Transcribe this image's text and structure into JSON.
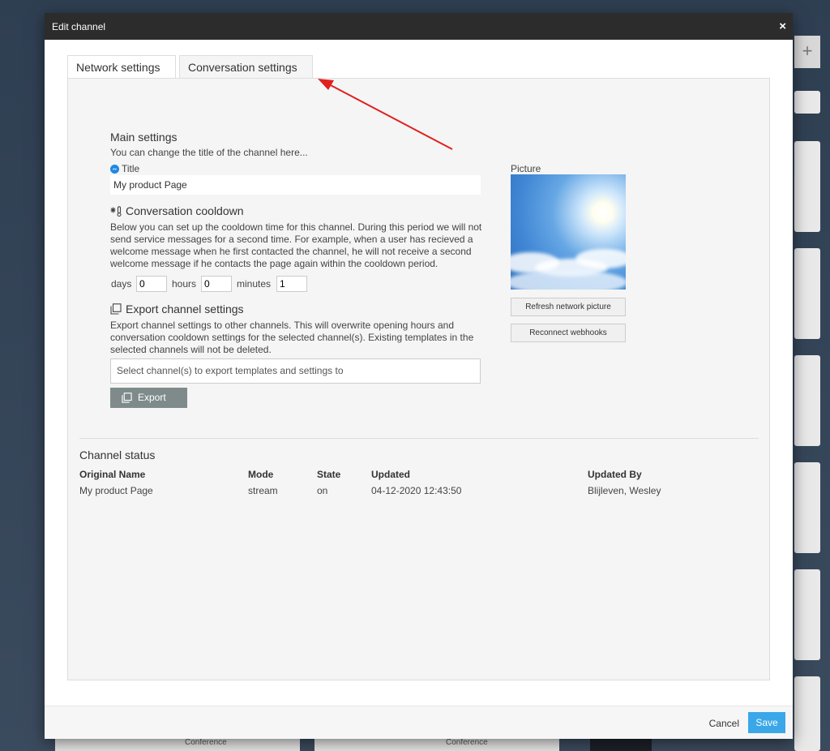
{
  "background": {
    "bottom_labels": [
      "Conference",
      "Conference"
    ],
    "plus_label": "+"
  },
  "modal": {
    "title": "Edit channel",
    "close_label": "×"
  },
  "tabs": [
    {
      "label": "Network settings",
      "active": false
    },
    {
      "label": "Conversation settings",
      "active": true
    }
  ],
  "main_settings": {
    "heading": "Main settings",
    "description": "You can change the title of the channel here...",
    "title_label": "Title",
    "title_value": "My product Page"
  },
  "cooldown": {
    "heading": "Conversation cooldown",
    "description": "Below you can set up the cooldown time for this channel. During this period we will not send service messages for a second time. For example, when a user has recieved a welcome message when he first contacted the channel, he will not receive a second welcome message if he contacts the page again within the cooldown period.",
    "days_label": "days",
    "days_value": "0",
    "hours_label": "hours",
    "hours_value": "0",
    "minutes_label": "minutes",
    "minutes_value": "1"
  },
  "export": {
    "heading": "Export channel settings",
    "description": "Export channel settings to other channels. This will overwrite opening hours and conversation cooldown settings for the selected channel(s). Existing templates in the selected channels will not be deleted.",
    "select_placeholder": "Select channel(s) to export templates and settings to",
    "button_label": "Export"
  },
  "picture": {
    "label": "Picture",
    "refresh_label": "Refresh network picture",
    "reconnect_label": "Reconnect webhooks"
  },
  "channel_status": {
    "heading": "Channel status",
    "columns": [
      "Original Name",
      "Mode",
      "State",
      "Updated",
      "Updated By"
    ],
    "row": [
      "My product Page",
      "stream",
      "on",
      "04-12-2020 12:43:50",
      "Blijleven, Wesley"
    ]
  },
  "footer": {
    "cancel_label": "Cancel",
    "save_label": "Save"
  },
  "colors": {
    "header_bg": "#2c2c2c",
    "save_button": "#3aa7e8",
    "export_button": "#7f8b8b",
    "annotation_arrow": "#e02020",
    "messenger_icon": "#1e88e5"
  }
}
